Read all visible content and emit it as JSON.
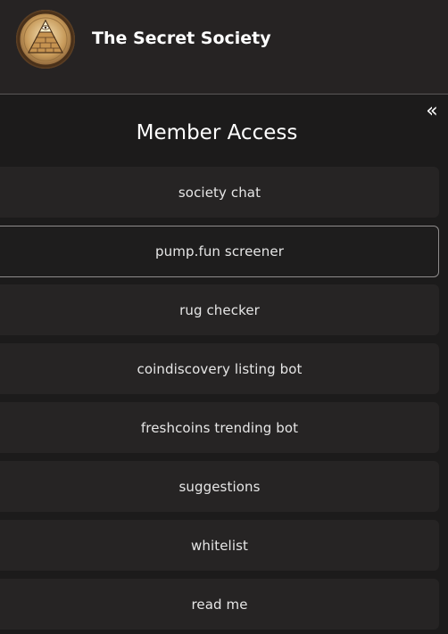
{
  "header": {
    "title": "The Secret Society",
    "logo_icon": "pyramid-eye-seal-icon"
  },
  "panel": {
    "title": "Member Access",
    "collapse_icon": "double-chevron-left-icon",
    "collapse_glyph": "«",
    "items": [
      {
        "label": "society chat"
      },
      {
        "label": "pump.fun screener"
      },
      {
        "label": "rug checker"
      },
      {
        "label": "coindiscovery listing bot"
      },
      {
        "label": "freshcoins trending bot"
      },
      {
        "label": "suggestions"
      },
      {
        "label": "whitelist"
      },
      {
        "label": "read me"
      }
    ]
  },
  "colors": {
    "background": "#1c1b1b",
    "header_bg": "#262323",
    "item_bg": "#262424",
    "text": "#ffffff",
    "active_border": "#8f8c8c"
  }
}
